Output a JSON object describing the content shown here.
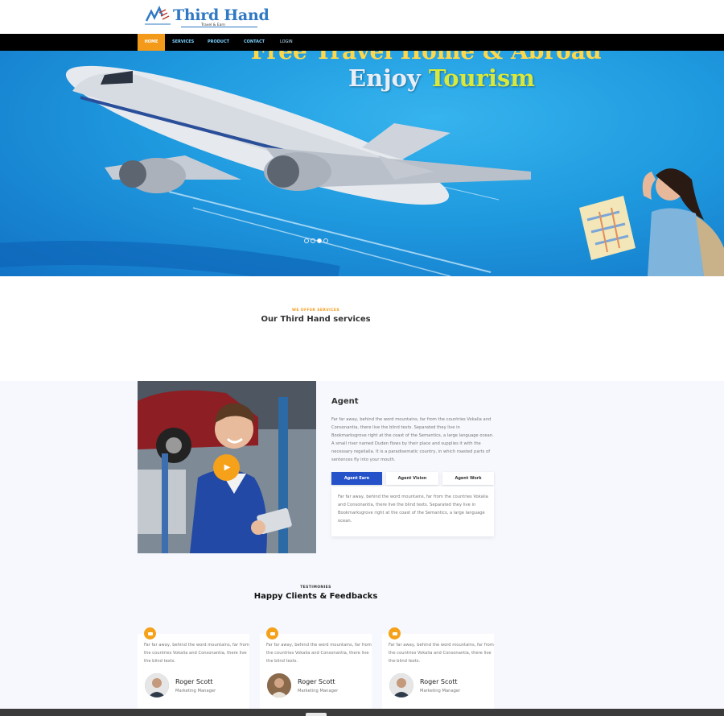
{
  "brand": {
    "name": "Third Hand",
    "tagline": "Travel & Earn"
  },
  "nav": {
    "items": [
      {
        "label": "HOME"
      },
      {
        "label": "SERVICES"
      },
      {
        "label": "PRODUCT"
      },
      {
        "label": "CONTACT"
      },
      {
        "label": "LOGIN"
      }
    ]
  },
  "hero": {
    "line1": "Free Travel Home & Abroad",
    "enjoy": "Enjoy",
    "tourism": "Tourism",
    "slides": 4,
    "active_slide": 3
  },
  "services": {
    "kicker": "WE OFFER SERVICES",
    "title": "Our Third Hand services"
  },
  "agent": {
    "title": "Agent",
    "paragraph": "Far far away, behind the word mountains, far from the countries Vokalia and Consonantia, there live the blind texts. Separated they live in Bookmarksgrove right at the coast of the Semantics, a large language ocean. A small river named Duden flows by their place and supplies it with the necessary regelialia. It is a paradisematic country, in which roasted parts of sentences fly into your mouth.",
    "tabs": [
      {
        "label": "Agent Earn"
      },
      {
        "label": "Agent Vision"
      },
      {
        "label": "Agent Work"
      }
    ],
    "tab_text": "Far far away, behind the word mountains, far from the countries Vokalia and Consonantia, there live the blind texts. Separated they live in Bookmarksgrove right at the coast of the Semantics, a large language ocean."
  },
  "testimonies": {
    "kicker": "TESTIMONIES",
    "title": "Happy Clients & Feedbacks",
    "cards": [
      {
        "text": "Far far away, behind the word mountains, far from the countries Vokalia and Consonantia, there live the blind texts.",
        "name": "Roger Scott",
        "role": "Marketing Manager"
      },
      {
        "text": "Far far away, behind the word mountains, far from the countries Vokalia and Consonantia, there live the blind texts.",
        "name": "Roger Scott",
        "role": "Marketing Manager"
      },
      {
        "text": "Far far away, behind the word mountains, far from the countries Vokalia and Consonantia, there live the blind texts.",
        "name": "Roger Scott",
        "role": "Marketing Manager"
      }
    ]
  },
  "colors": {
    "accent": "#f49a1a",
    "nav_bg": "#000000",
    "tab_active": "#2552c9",
    "logo_blue": "#2f78c4"
  },
  "icons": {
    "play": "play-icon",
    "quote": "quote-icon"
  }
}
